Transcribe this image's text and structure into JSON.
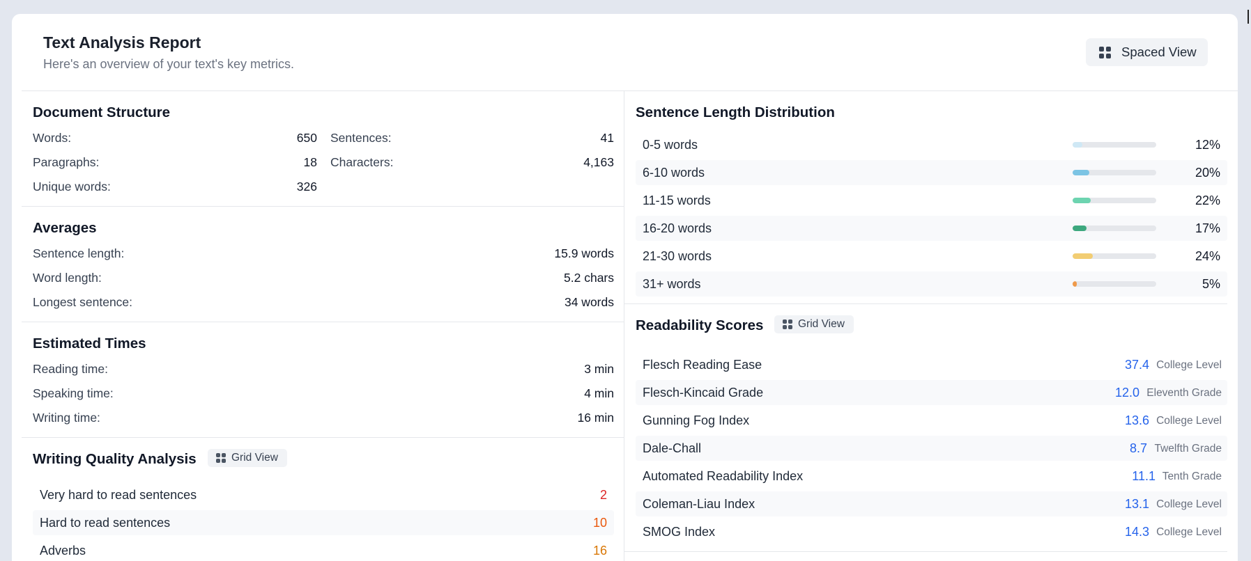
{
  "header": {
    "title": "Text Analysis Report",
    "subtitle": "Here's an overview of your text's key metrics.",
    "view_button": "Spaced View"
  },
  "structure": {
    "title": "Document Structure",
    "words_label": "Words:",
    "words": "650",
    "sentences_label": "Sentences:",
    "sentences": "41",
    "paragraphs_label": "Paragraphs:",
    "paragraphs": "18",
    "characters_label": "Characters:",
    "characters": "4,163",
    "unique_label": "Unique words:",
    "unique": "326"
  },
  "averages": {
    "title": "Averages",
    "items": [
      {
        "label": "Sentence length:",
        "value": "15.9 words"
      },
      {
        "label": "Word length:",
        "value": "5.2 chars"
      },
      {
        "label": "Longest sentence:",
        "value": "34 words"
      }
    ]
  },
  "times": {
    "title": "Estimated Times",
    "items": [
      {
        "label": "Reading time:",
        "value": "3 min"
      },
      {
        "label": "Speaking time:",
        "value": "4 min"
      },
      {
        "label": "Writing time:",
        "value": "16 min"
      }
    ]
  },
  "quality": {
    "title": "Writing Quality Analysis",
    "view_button": "Grid View",
    "items": [
      {
        "label": "Very hard to read sentences",
        "value": "2",
        "color": "#dc2626"
      },
      {
        "label": "Hard to read sentences",
        "value": "10",
        "color": "#ea580c"
      },
      {
        "label": "Adverbs",
        "value": "16",
        "color": "#d97706"
      }
    ]
  },
  "distribution": {
    "title": "Sentence Length Distribution",
    "items": [
      {
        "label": "0-5 words",
        "value": "12%",
        "fraction": 0.12,
        "color": "#cfe8f5"
      },
      {
        "label": "6-10 words",
        "value": "20%",
        "fraction": 0.2,
        "color": "#7cc4e4"
      },
      {
        "label": "11-15 words",
        "value": "22%",
        "fraction": 0.22,
        "color": "#6dd4b0"
      },
      {
        "label": "16-20 words",
        "value": "17%",
        "fraction": 0.17,
        "color": "#3da87e"
      },
      {
        "label": "21-30 words",
        "value": "24%",
        "fraction": 0.24,
        "color": "#f2cd73"
      },
      {
        "label": "31+ words",
        "value": "5%",
        "fraction": 0.05,
        "color": "#ef9a4a"
      }
    ]
  },
  "readability": {
    "title": "Readability Scores",
    "view_button": "Grid View",
    "score_color": "#2563eb",
    "items": [
      {
        "label": "Flesch Reading Ease",
        "score": "37.4",
        "grade": "College Level"
      },
      {
        "label": "Flesch-Kincaid Grade",
        "score": "12.0",
        "grade": "Eleventh Grade"
      },
      {
        "label": "Gunning Fog Index",
        "score": "13.6",
        "grade": "College Level"
      },
      {
        "label": "Dale-Chall",
        "score": "8.7",
        "grade": "Twelfth Grade"
      },
      {
        "label": "Automated Readability Index",
        "score": "11.1",
        "grade": "Tenth Grade"
      },
      {
        "label": "Coleman-Liau Index",
        "score": "13.1",
        "grade": "College Level"
      },
      {
        "label": "SMOG Index",
        "score": "14.3",
        "grade": "College Level"
      }
    ]
  }
}
